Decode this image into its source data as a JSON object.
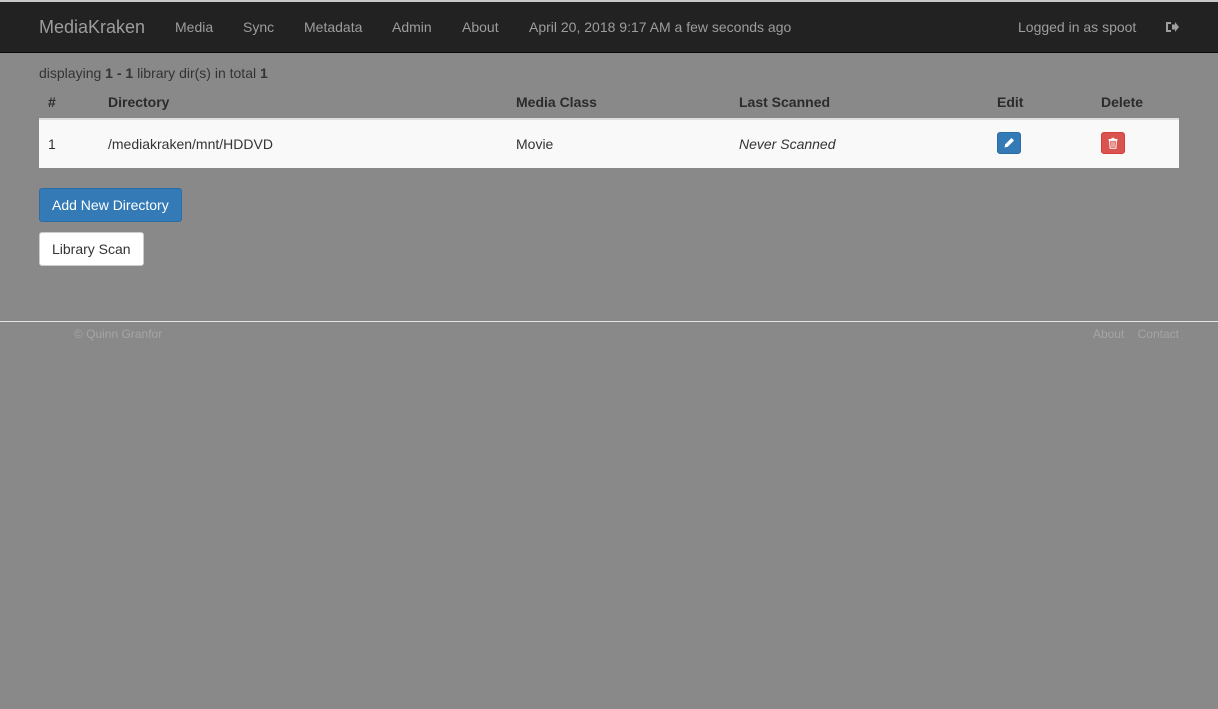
{
  "navbar": {
    "brand": "MediaKraken",
    "items": [
      {
        "label": "Media"
      },
      {
        "label": "Sync"
      },
      {
        "label": "Metadata"
      },
      {
        "label": "Admin"
      },
      {
        "label": "About"
      }
    ],
    "datetime": "April 20, 2018 9:17 AM a few seconds ago",
    "user_text": "Logged in as spoot",
    "logout_icon": "sign-out-icon"
  },
  "summary": {
    "prefix": "displaying",
    "range": "1 - 1",
    "middle": "library dir(s) in total",
    "total": "1"
  },
  "table": {
    "headers": [
      "#",
      "Directory",
      "Media Class",
      "Last Scanned",
      "Edit",
      "Delete"
    ],
    "rows": [
      {
        "num": "1",
        "directory": "/mediakraken/mnt/HDDVD",
        "media_class": "Movie",
        "last_scanned": "Never Scanned",
        "edit_icon": "pencil-icon",
        "delete_icon": "trash-icon"
      }
    ]
  },
  "buttons": {
    "add_new_directory": "Add New Directory",
    "library_scan": "Library Scan"
  },
  "footer": {
    "copyright": "© Quinn Granfor",
    "links": [
      "About",
      "Contact"
    ]
  },
  "colors": {
    "primary": "#337ab7",
    "danger": "#d9534f",
    "navbar": "#222222"
  }
}
